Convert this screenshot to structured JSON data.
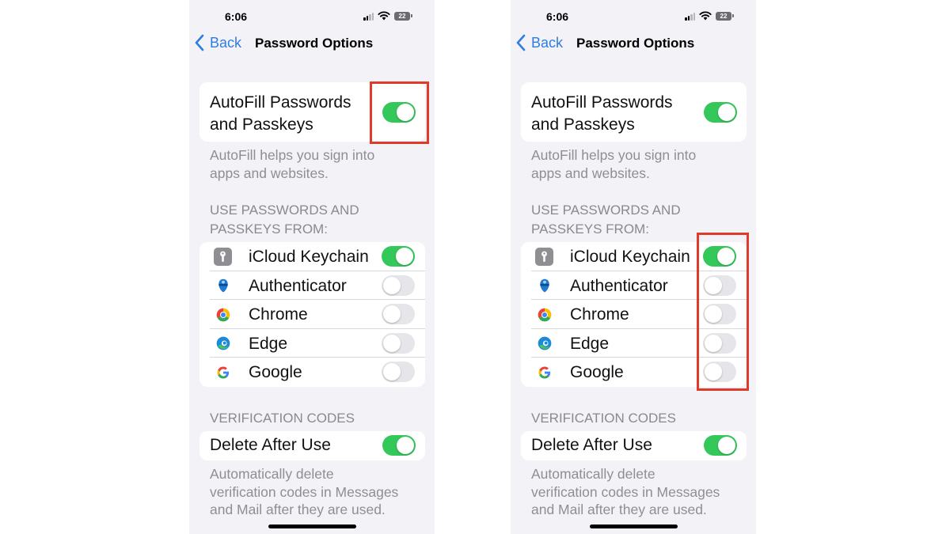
{
  "colors": {
    "toggle_on": "#34c759",
    "toggle_off": "#e6e6ea",
    "accent_blue": "#2f7de1",
    "highlight_red": "#e03a2a",
    "background": "#f2f2f7"
  },
  "screens": [
    {
      "status_bar": {
        "time": "6:06",
        "battery": "22",
        "icons": [
          "signal-icon",
          "wifi-icon",
          "battery-icon"
        ]
      },
      "nav": {
        "back_label": "Back",
        "title": "Password Options"
      },
      "autofill": {
        "label_line1": "AutoFill Passwords",
        "label_line2": "and Passkeys",
        "enabled": true
      },
      "autofill_footer": {
        "line1": "AutoFill helps you sign into",
        "line2": "apps and websites."
      },
      "providers_header": {
        "line1": "USE PASSWORDS AND",
        "line2": "PASSKEYS FROM:"
      },
      "providers": [
        {
          "label": "iCloud Keychain",
          "icon": "keychain-icon",
          "enabled": true
        },
        {
          "label": "Authenticator",
          "icon": "authenticator-icon",
          "enabled": false
        },
        {
          "label": "Chrome",
          "icon": "chrome-icon",
          "enabled": false
        },
        {
          "label": "Edge",
          "icon": "edge-icon",
          "enabled": false
        },
        {
          "label": "Google",
          "icon": "google-icon",
          "enabled": false
        }
      ],
      "verification_header": "VERIFICATION CODES",
      "delete_after_use": {
        "label": "Delete After Use",
        "enabled": true
      },
      "delete_footer": {
        "line1": "Automatically delete",
        "line2": "verification codes in Messages",
        "line3": "and Mail after they are used."
      },
      "highlight": "autofill-toggle"
    },
    {
      "status_bar": {
        "time": "6:06",
        "battery": "22",
        "icons": [
          "signal-icon",
          "wifi-icon",
          "battery-icon"
        ]
      },
      "nav": {
        "back_label": "Back",
        "title": "Password Options"
      },
      "autofill": {
        "label_line1": "AutoFill Passwords",
        "label_line2": "and Passkeys",
        "enabled": true
      },
      "autofill_footer": {
        "line1": "AutoFill helps you sign into",
        "line2": "apps and websites."
      },
      "providers_header": {
        "line1": "USE PASSWORDS AND",
        "line2": "PASSKEYS FROM:"
      },
      "providers": [
        {
          "label": "iCloud Keychain",
          "icon": "keychain-icon",
          "enabled": true
        },
        {
          "label": "Authenticator",
          "icon": "authenticator-icon",
          "enabled": false
        },
        {
          "label": "Chrome",
          "icon": "chrome-icon",
          "enabled": false
        },
        {
          "label": "Edge",
          "icon": "edge-icon",
          "enabled": false
        },
        {
          "label": "Google",
          "icon": "google-icon",
          "enabled": false
        }
      ],
      "verification_header": "VERIFICATION CODES",
      "delete_after_use": {
        "label": "Delete After Use",
        "enabled": true
      },
      "delete_footer": {
        "line1": "Automatically delete",
        "line2": "verification codes in Messages",
        "line3": "and Mail after they are used."
      },
      "highlight": "provider-toggles"
    }
  ]
}
